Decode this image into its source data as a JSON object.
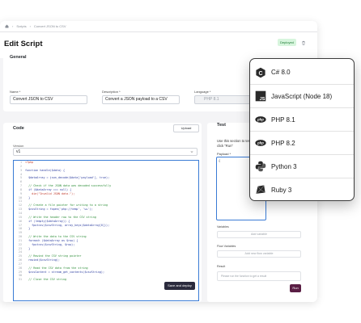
{
  "breadcrumb": {
    "scripts": "Scripts",
    "current": "Convert JSON to CSV"
  },
  "page": {
    "title": "Edit Script",
    "status": "Deployed"
  },
  "general": {
    "section_title": "General",
    "name_label": "Name *",
    "name_value": "Convert JSON to CSV",
    "description_label": "Description *",
    "description_value": "Convert a JSON payload to a CSV",
    "language_label": "Language *",
    "language_value": "PHP 8.1"
  },
  "code": {
    "section_title": "Code",
    "upload_label": "Upload",
    "version_label": "Version",
    "version_value": "v1",
    "save_label": "Save and deploy",
    "lines": [
      {
        "n": "1",
        "t": "<?php",
        "k": "s"
      },
      {
        "n": "2",
        "t": "",
        "k": ""
      },
      {
        "n": "3",
        "t": "function handle($data) {",
        "k": ""
      },
      {
        "n": "4",
        "t": "",
        "k": ""
      },
      {
        "n": "5",
        "t": "  $dataArray = json_decode($data['payload'], true);",
        "k": ""
      },
      {
        "n": "6",
        "t": "",
        "k": ""
      },
      {
        "n": "7",
        "t": "  // Check if the JSON data was decoded successfully",
        "k": "c"
      },
      {
        "n": "8",
        "t": "  if ($dataArray === null) {",
        "k": ""
      },
      {
        "n": "9",
        "t": "    die(\"Invalid JSON data.\");",
        "k": "s"
      },
      {
        "n": "10",
        "t": "  }",
        "k": ""
      },
      {
        "n": "11",
        "t": "",
        "k": ""
      },
      {
        "n": "12",
        "t": "  // Create a file pointer for writing to a string",
        "k": "c"
      },
      {
        "n": "13",
        "t": "  $csvString = fopen('php://temp', 'w+');",
        "k": ""
      },
      {
        "n": "14",
        "t": "",
        "k": ""
      },
      {
        "n": "15",
        "t": "  // Write the header row to the CSV string",
        "k": "c"
      },
      {
        "n": "16",
        "t": "  if (!empty($dataArray)) {",
        "k": ""
      },
      {
        "n": "17",
        "t": "    fputcsv($csvString, array_keys($dataArray[0]));",
        "k": ""
      },
      {
        "n": "18",
        "t": "  }",
        "k": ""
      },
      {
        "n": "19",
        "t": "",
        "k": ""
      },
      {
        "n": "20",
        "t": "  // Write the data to the CSV string",
        "k": "c"
      },
      {
        "n": "21",
        "t": "  foreach ($dataArray as $row) {",
        "k": ""
      },
      {
        "n": "22",
        "t": "    fputcsv($csvString, $row);",
        "k": ""
      },
      {
        "n": "23",
        "t": "  }",
        "k": ""
      },
      {
        "n": "24",
        "t": "",
        "k": ""
      },
      {
        "n": "25",
        "t": "  // Rewind the CSV string pointer",
        "k": "c"
      },
      {
        "n": "26",
        "t": "  rewind($csvString);",
        "k": ""
      },
      {
        "n": "27",
        "t": "",
        "k": ""
      },
      {
        "n": "28",
        "t": "  // Read the CSV data from the string",
        "k": "c"
      },
      {
        "n": "29",
        "t": "  $csvContent = stream_get_contents($csvString);",
        "k": ""
      },
      {
        "n": "30",
        "t": "",
        "k": ""
      },
      {
        "n": "31",
        "t": "  // Close the CSV string",
        "k": "c"
      }
    ]
  },
  "test": {
    "section_title": "Test",
    "description": "Use this section to test and then click \"Run\"",
    "payload_label": "Payload *",
    "payload_value": "{",
    "variables_label": "Variables",
    "add_variable": "Add variable",
    "flow_variables_label": "Flow Variables",
    "add_flow_variable": "Add new flow variable",
    "result_label": "Result",
    "result_placeholder": "Please run the function to get a result",
    "run_label": "Run"
  },
  "languages": [
    {
      "name": "C# 8.0",
      "icon": "csharp-icon",
      "color": "#1f1f1f"
    },
    {
      "name": "JavaScript (Node 18)",
      "icon": "javascript-icon",
      "color": "#1f1f1f"
    },
    {
      "name": "PHP 8.1",
      "icon": "php-icon",
      "color": "#1f1f1f"
    },
    {
      "name": "PHP 8.2",
      "icon": "php-icon",
      "color": "#1f1f1f"
    },
    {
      "name": "Python 3",
      "icon": "python-icon",
      "color": "#1f1f1f"
    },
    {
      "name": "Ruby 3",
      "icon": "ruby-icon",
      "color": "#1f1f1f"
    }
  ]
}
